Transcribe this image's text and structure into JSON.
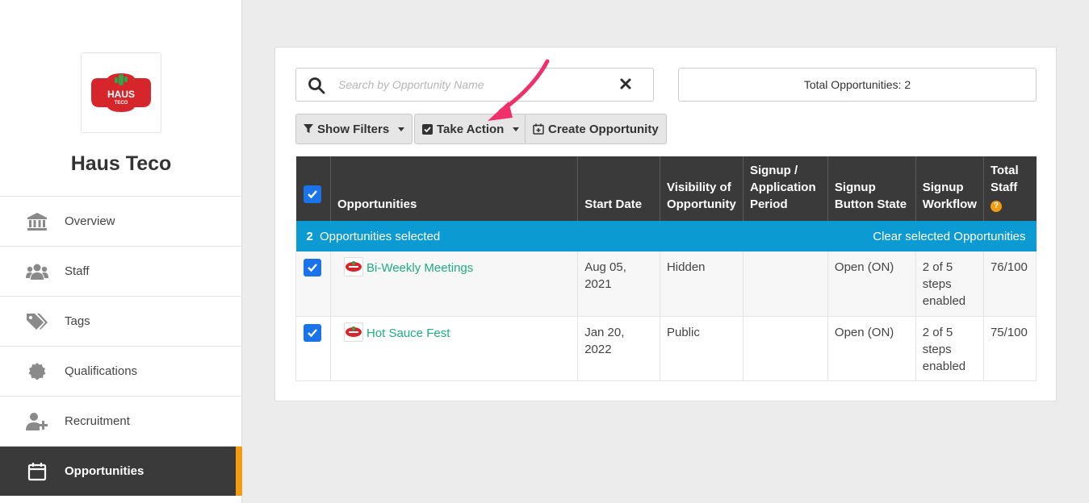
{
  "org": {
    "name": "Haus Teco",
    "logo_text": "HAUS TECO"
  },
  "sidebar": {
    "items": [
      {
        "label": "Overview",
        "icon": "bank-icon"
      },
      {
        "label": "Staff",
        "icon": "users-icon"
      },
      {
        "label": "Tags",
        "icon": "tags-icon"
      },
      {
        "label": "Qualifications",
        "icon": "certificate-icon"
      },
      {
        "label": "Recruitment",
        "icon": "user-plus-icon"
      },
      {
        "label": "Opportunities",
        "icon": "calendar-icon",
        "active": true
      }
    ]
  },
  "search": {
    "placeholder": "Search by Opportunity Name"
  },
  "total": {
    "label": "Total Opportunities: 2"
  },
  "toolbar": {
    "filters_label": "Show Filters",
    "action_label": "Take Action",
    "create_label": "Create Opportunity"
  },
  "table": {
    "headers": [
      "Opportunities",
      "Start Date",
      "Visibility of Opportunity",
      "Signup / Application Period",
      "Signup Button State",
      "Signup Workflow",
      "Total Staff"
    ],
    "selection": {
      "count": "2",
      "text": "Opportunities selected",
      "clear": "Clear selected Opportunities"
    },
    "rows": [
      {
        "name": "Bi-Weekly Meetings",
        "start": "Aug 05, 2021",
        "visibility": "Hidden",
        "period": "",
        "button_state": "Open (ON)",
        "workflow": "2 of 5 steps enabled",
        "total_staff": "76/100"
      },
      {
        "name": "Hot Sauce Fest",
        "start": "Jan 20, 2022",
        "visibility": "Public",
        "period": "",
        "button_state": "Open (ON)",
        "workflow": "2 of 5 steps enabled",
        "total_staff": "75/100"
      }
    ]
  },
  "colors": {
    "accent": "#f39c12",
    "selection_bar": "#0b9ad1",
    "link": "#1fae7d",
    "checkbox": "#1a73e8",
    "annotation_arrow": "#f0306a"
  }
}
